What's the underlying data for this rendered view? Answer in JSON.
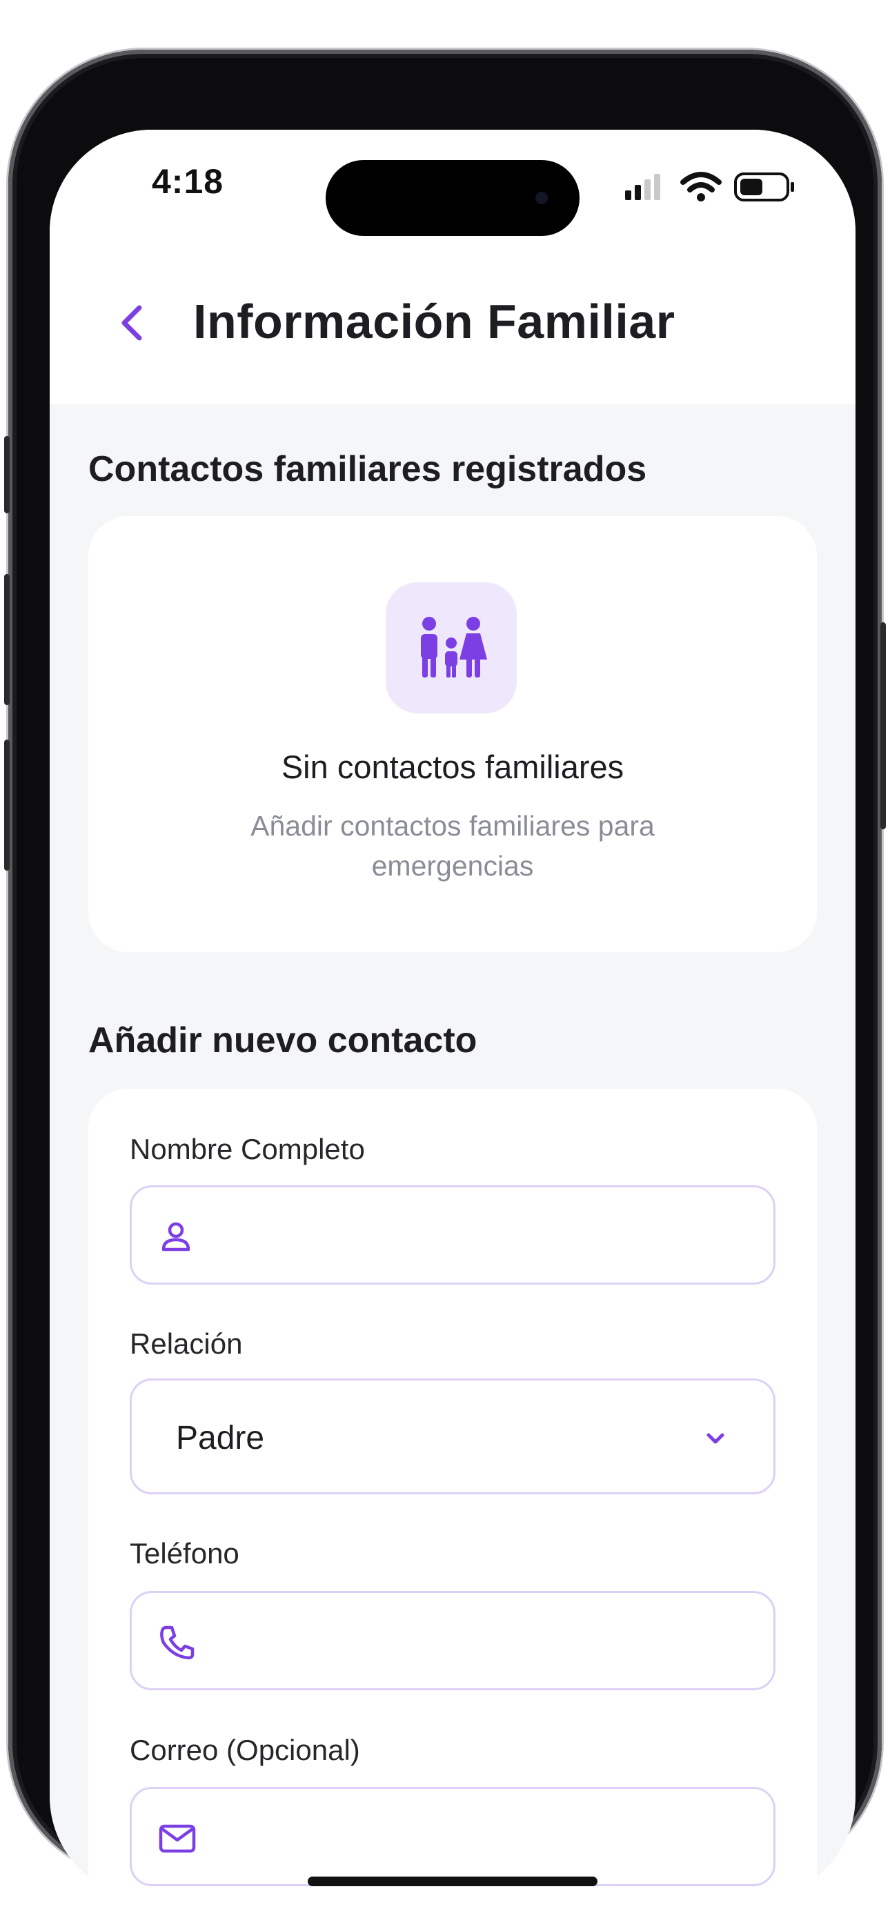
{
  "status_bar": {
    "time": "4:18"
  },
  "header": {
    "title": "Información Familiar",
    "back_icon": "chevron-left-icon"
  },
  "registered": {
    "section_title": "Contactos familiares registrados",
    "empty_icon": "family-icon",
    "empty_title": "Sin contactos familiares",
    "empty_subtitle": "Añadir contactos familiares para emergencias"
  },
  "add_contact": {
    "section_title": "Añadir nuevo contacto",
    "name_label": "Nombre Completo",
    "name_value": "",
    "relation_label": "Relación",
    "relation_value": "Padre",
    "phone_label": "Teléfono",
    "phone_value": "",
    "email_label": "Correo (Opcional)",
    "email_value": ""
  },
  "colors": {
    "accent": "#7b3fe4",
    "accent_light": "#efe8fc",
    "field_border": "#ddd0f6",
    "background": "#f5f6f8"
  }
}
